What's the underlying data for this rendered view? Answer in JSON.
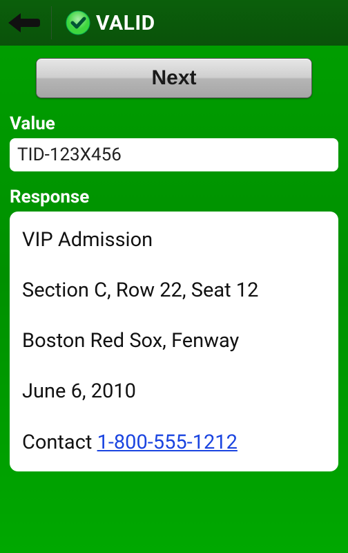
{
  "header": {
    "status_label": "VALID"
  },
  "buttons": {
    "next": "Next"
  },
  "value": {
    "label": "Value",
    "content": "TID-123X456"
  },
  "response": {
    "label": "Response",
    "admission": "VIP Admission",
    "seating": "Section C, Row 22, Seat 12",
    "event": "Boston Red Sox, Fenway",
    "date": "June 6, 2010",
    "contact_prefix": "Contact ",
    "contact_phone": "1-800-555-1212"
  }
}
